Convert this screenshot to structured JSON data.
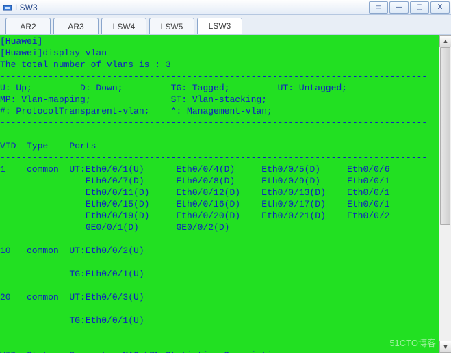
{
  "window": {
    "title": "LSW3",
    "buttons": {
      "float": "▭",
      "min": "—",
      "max": "▢",
      "close": "X"
    }
  },
  "tabs": [
    {
      "label": "AR2",
      "active": false
    },
    {
      "label": "AR3",
      "active": false
    },
    {
      "label": "LSW4",
      "active": false
    },
    {
      "label": "LSW5",
      "active": false
    },
    {
      "label": "LSW3",
      "active": true
    }
  ],
  "terminal": {
    "lines": [
      "[Huawei]",
      "[Huawei]display vlan",
      "The total number of vlans is : 3",
      "--------------------------------------------------------------------------------",
      "U: Up;         D: Down;         TG: Tagged;         UT: Untagged;",
      "MP: Vlan-mapping;               ST: Vlan-stacking;",
      "#: ProtocolTransparent-vlan;    *: Management-vlan;",
      "--------------------------------------------------------------------------------",
      "",
      "VID  Type    Ports",
      "--------------------------------------------------------------------------------",
      "1    common  UT:Eth0/0/1(U)      Eth0/0/4(D)     Eth0/0/5(D)     Eth0/0/6",
      "                Eth0/0/7(D)      Eth0/0/8(D)     Eth0/0/9(D)     Eth0/0/1",
      "                Eth0/0/11(D)     Eth0/0/12(D)    Eth0/0/13(D)    Eth0/0/1",
      "                Eth0/0/15(D)     Eth0/0/16(D)    Eth0/0/17(D)    Eth0/0/1",
      "                Eth0/0/19(D)     Eth0/0/20(D)    Eth0/0/21(D)    Eth0/0/2",
      "                GE0/0/1(D)       GE0/0/2(D)",
      "",
      "10   common  UT:Eth0/0/2(U)",
      "",
      "             TG:Eth0/0/1(U)",
      "",
      "20   common  UT:Eth0/0/3(U)",
      "",
      "             TG:Eth0/0/1(U)",
      "",
      "",
      "VID  Status  Property  MAC-LRN Statistics Description"
    ]
  },
  "watermark": "51CTO博客",
  "scrollbar": {
    "up": "▲",
    "down": "▼"
  }
}
